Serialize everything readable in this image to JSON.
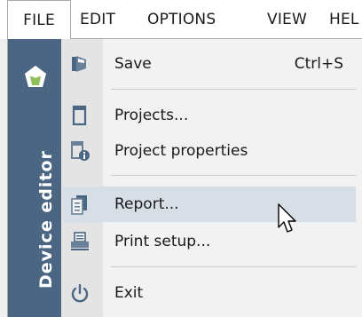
{
  "menubar": {
    "items": [
      {
        "label": "FILE",
        "active": true
      },
      {
        "label": "EDIT",
        "active": false
      },
      {
        "label": "OPTIONS",
        "active": false
      },
      {
        "label": "VIEW",
        "active": false
      },
      {
        "label": "HEL",
        "active": false
      }
    ]
  },
  "sidebar": {
    "title": "Device editor",
    "logo_icon": "device-logo-icon",
    "color": "#4a6683"
  },
  "file_menu": {
    "items": [
      {
        "label": "Save",
        "shortcut": "Ctrl+S",
        "icon": "save-icon"
      },
      {
        "label": "Projects...",
        "icon": "projects-icon"
      },
      {
        "label": "Project properties",
        "icon": "project-properties-icon"
      },
      {
        "label": "Report...",
        "icon": "report-icon",
        "hovered": true
      },
      {
        "label": "Print setup...",
        "icon": "print-icon"
      },
      {
        "label": "Exit",
        "icon": "power-icon"
      }
    ],
    "hover_color": "#d8dee6",
    "icon_color": "#4a6683"
  }
}
